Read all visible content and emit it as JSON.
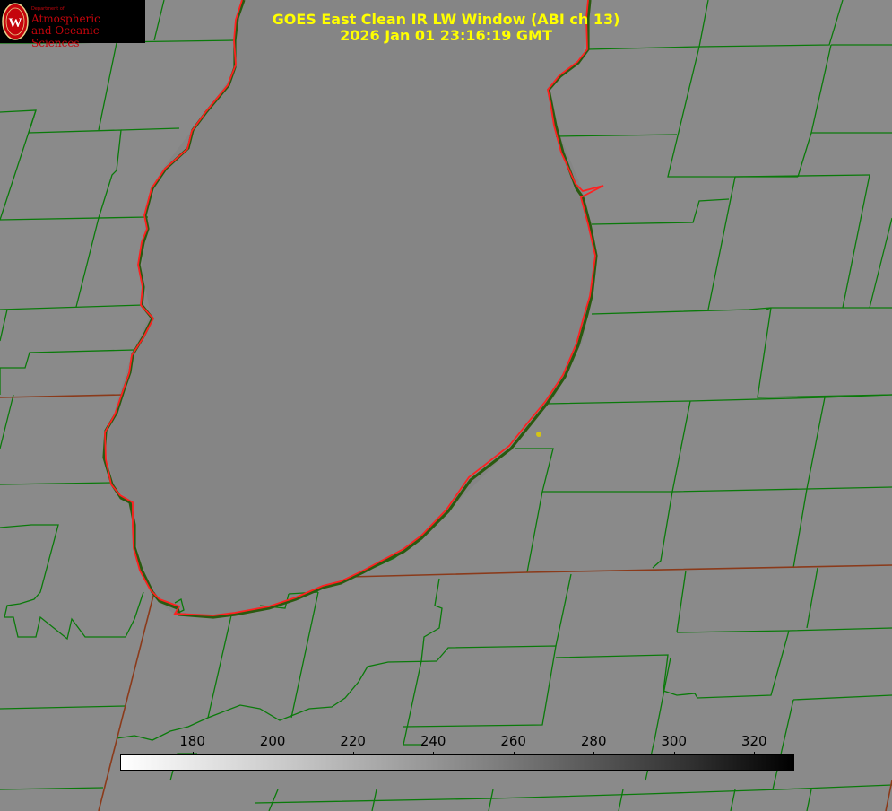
{
  "title": {
    "line1": "GOES East Clean IR LW Window (ABI ch 13)",
    "line2": "2026 Jan 01 23:16:19 GMT"
  },
  "logo": {
    "department": "Department of",
    "line1": "Atmospheric",
    "line2": "and Oceanic Sciences",
    "seal_letter": "W"
  },
  "colorbar": {
    "ticks": [
      "180",
      "200",
      "220",
      "240",
      "260",
      "280",
      "300",
      "320"
    ],
    "min_value": 162,
    "max_value": 330,
    "palette": [
      "#ffffff",
      "#000000"
    ]
  },
  "colors": {
    "background": "#8a8a8a",
    "lake": "#858585",
    "county_lines": "#0a7a0a",
    "state_lines": "#8b3a1a",
    "shoreline": "#ff2020",
    "title_text": "#ffff00",
    "marker": "#d4c414"
  },
  "map": {
    "feature": "lake-michigan",
    "marker": "yellow-dot"
  }
}
